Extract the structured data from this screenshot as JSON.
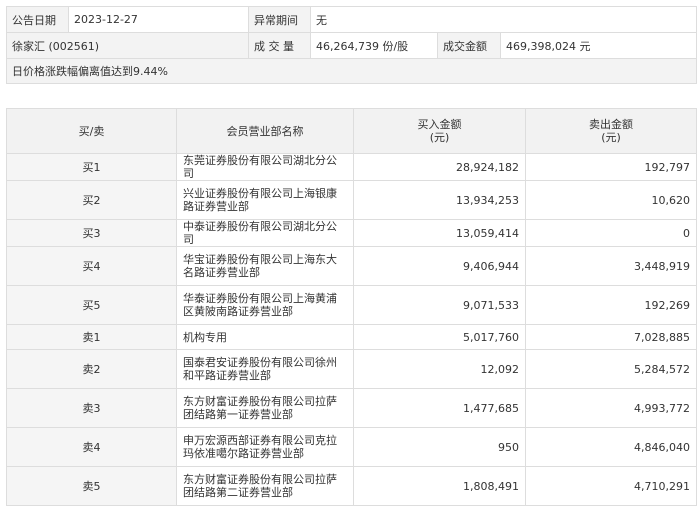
{
  "info": {
    "date_label": "公告日期",
    "date_value": "2023-12-27",
    "period_label": "异常期间",
    "period_value": "无",
    "stock_name": "徐家汇 (002561)",
    "volume_label": "成 交 量",
    "volume_value": "46,264,739 份/股",
    "amount_label": "成交金额",
    "amount_value": "469,398,024 元",
    "note": "日价格涨跌幅偏离值达到9.44%"
  },
  "table": {
    "headers": {
      "side": "买/卖",
      "branch": "会员营业部名称",
      "buy": "买入金额",
      "buy_unit": "(元)",
      "sell": "卖出金额",
      "sell_unit": "(元)"
    },
    "rows": [
      {
        "side": "买1",
        "branch": "东莞证券股份有限公司湖北分公司",
        "buy": "28,924,182",
        "sell": "192,797"
      },
      {
        "side": "买2",
        "branch": "兴业证券股份有限公司上海银康路证券营业部",
        "buy": "13,934,253",
        "sell": "10,620"
      },
      {
        "side": "买3",
        "branch": "中泰证券股份有限公司湖北分公司",
        "buy": "13,059,414",
        "sell": "0"
      },
      {
        "side": "买4",
        "branch": "华宝证券股份有限公司上海东大名路证券营业部",
        "buy": "9,406,944",
        "sell": "3,448,919"
      },
      {
        "side": "买5",
        "branch": "华泰证券股份有限公司上海黄浦区黄陂南路证券营业部",
        "buy": "9,071,533",
        "sell": "192,269"
      },
      {
        "side": "卖1",
        "branch": "机构专用",
        "buy": "5,017,760",
        "sell": "7,028,885"
      },
      {
        "side": "卖2",
        "branch": "国泰君安证券股份有限公司徐州和平路证券营业部",
        "buy": "12,092",
        "sell": "5,284,572"
      },
      {
        "side": "卖3",
        "branch": "东方财富证券股份有限公司拉萨团结路第一证券营业部",
        "buy": "1,477,685",
        "sell": "4,993,772"
      },
      {
        "side": "卖4",
        "branch": "申万宏源西部证券有限公司克拉玛依准噶尔路证券营业部",
        "buy": "950",
        "sell": "4,846,040"
      },
      {
        "side": "卖5",
        "branch": "东方财富证券股份有限公司拉萨团结路第二证券营业部",
        "buy": "1,808,491",
        "sell": "4,710,291"
      }
    ]
  }
}
